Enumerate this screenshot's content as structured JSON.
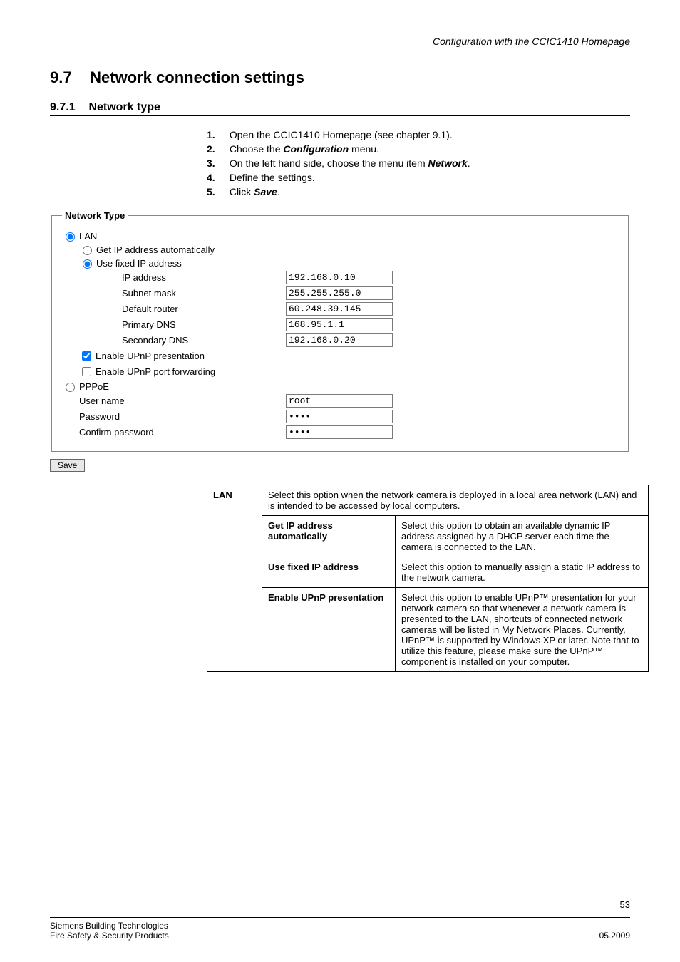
{
  "header": {
    "doc_title": "Configuration with the CCIC1410 Homepage"
  },
  "section": {
    "num": "9.7",
    "title": "Network connection settings",
    "sub_num": "9.7.1",
    "sub_title": "Network type"
  },
  "steps": [
    {
      "n": "1.",
      "t_pre": "Open the CCIC1410 Homepage (see chapter 9.1)."
    },
    {
      "n": "2.",
      "t_pre": "Choose the ",
      "bi": "Configuration",
      "t_post": " menu."
    },
    {
      "n": "3.",
      "t_pre": "On the left hand side, choose the menu item ",
      "bi": "Network",
      "t_post": "."
    },
    {
      "n": "4.",
      "t_pre": "Define the settings."
    },
    {
      "n": "5.",
      "t_pre": "Click ",
      "bi": "Save",
      "t_post": "."
    }
  ],
  "panel": {
    "legend": "Network Type",
    "lan_label": "LAN",
    "get_ip_label": "Get IP address automatically",
    "use_fixed_label": "Use fixed IP address",
    "ip_address_label": "IP address",
    "ip_address_value": "192.168.0.10",
    "subnet_label": "Subnet mask",
    "subnet_value": "255.255.255.0",
    "router_label": "Default router",
    "router_value": "60.248.39.145",
    "pdns_label": "Primary DNS",
    "pdns_value": "168.95.1.1",
    "sdns_label": "Secondary DNS",
    "sdns_value": "192.168.0.20",
    "upnp_pres_label": "Enable UPnP presentation",
    "upnp_port_label": "Enable UPnP port forwarding",
    "pppoe_label": "PPPoE",
    "user_label": "User name",
    "user_value": "root",
    "pass_label": "Password",
    "pass_value": "••••",
    "cpass_label": "Confirm password",
    "cpass_value": "••••",
    "save_label": "Save"
  },
  "table": {
    "lan_key": "LAN",
    "lan_desc": "Select this option when the network camera is deployed in a local area network (LAN) and is intended to be accessed by local computers.",
    "get_ip_key": "Get IP address automatically",
    "get_ip_desc": "Select this option to obtain an available dynamic IP address assigned by a DHCP server each time the camera is connected to the LAN.",
    "fixed_key": "Use fixed IP address",
    "fixed_desc": "Select this option to manually assign a static IP address to the network camera.",
    "upnp_key": "Enable UPnP presentation",
    "upnp_desc": "Select this option to enable UPnP™ presentation for your network camera so that whenever a network camera is presented to the LAN, shortcuts of connected network cameras will be listed in My Network Places. Currently, UPnP™ is supported by Windows XP or later. Note that to utilize this feature, please make sure the UPnP™ component is installed on your computer."
  },
  "footer": {
    "page": "53",
    "org1": "Siemens Building Technologies",
    "org2": "Fire Safety & Security Products",
    "date": "05.2009"
  }
}
